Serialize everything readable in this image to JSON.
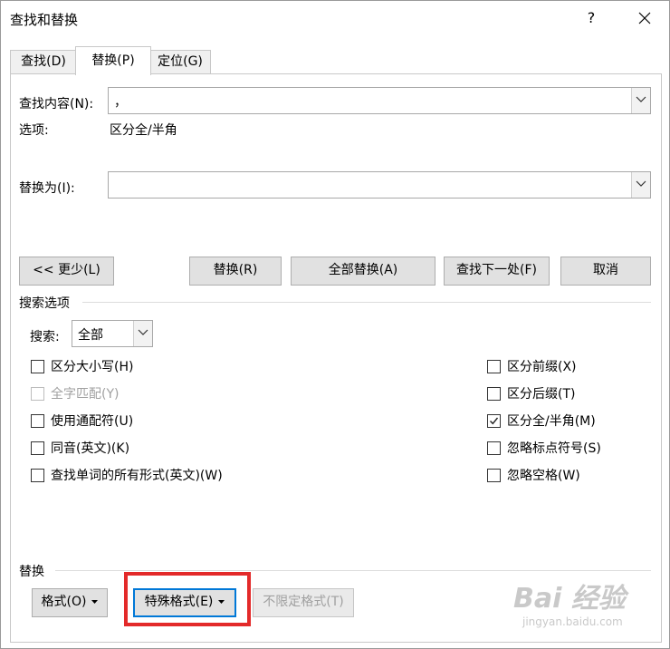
{
  "window": {
    "title": "查找和替换",
    "help": "?",
    "close_icon": "close-icon"
  },
  "tabs": [
    {
      "label": "查找(D)",
      "active": false
    },
    {
      "label": "替换(P)",
      "active": true
    },
    {
      "label": "定位(G)",
      "active": false
    }
  ],
  "find": {
    "label": "查找内容(N):",
    "value": "，"
  },
  "options": {
    "label": "选项:",
    "value": "区分全/半角"
  },
  "replace": {
    "label": "替换为(I):",
    "value": ""
  },
  "buttons": {
    "less": "<< 更少(L)",
    "replace": "替换(R)",
    "replace_all": "全部替换(A)",
    "find_next": "查找下一处(F)",
    "cancel": "取消"
  },
  "search_options": {
    "heading": "搜索选项",
    "search_label": "搜索:",
    "search_value": "全部",
    "left": [
      {
        "label": "区分大小写(H)",
        "checked": false,
        "disabled": false
      },
      {
        "label": "全字匹配(Y)",
        "checked": false,
        "disabled": true
      },
      {
        "label": "使用通配符(U)",
        "checked": false,
        "disabled": false
      },
      {
        "label": "同音(英文)(K)",
        "checked": false,
        "disabled": false
      },
      {
        "label": "查找单词的所有形式(英文)(W)",
        "checked": false,
        "disabled": false
      }
    ],
    "right": [
      {
        "label": "区分前缀(X)",
        "checked": false,
        "disabled": false
      },
      {
        "label": "区分后缀(T)",
        "checked": false,
        "disabled": false
      },
      {
        "label": "区分全/半角(M)",
        "checked": true,
        "disabled": false
      },
      {
        "label": "忽略标点符号(S)",
        "checked": false,
        "disabled": false
      },
      {
        "label": "忽略空格(W)",
        "checked": false,
        "disabled": false
      }
    ]
  },
  "replace_section": {
    "heading": "替换",
    "format": "格式(O)",
    "special": "特殊格式(E)",
    "no_format": "不限定格式(T)"
  },
  "watermark": {
    "main": "Bai 经验",
    "sub": "jingyan.baidu.com"
  },
  "colors": {
    "highlight": "#e32a2a",
    "focus": "#0078d7"
  }
}
